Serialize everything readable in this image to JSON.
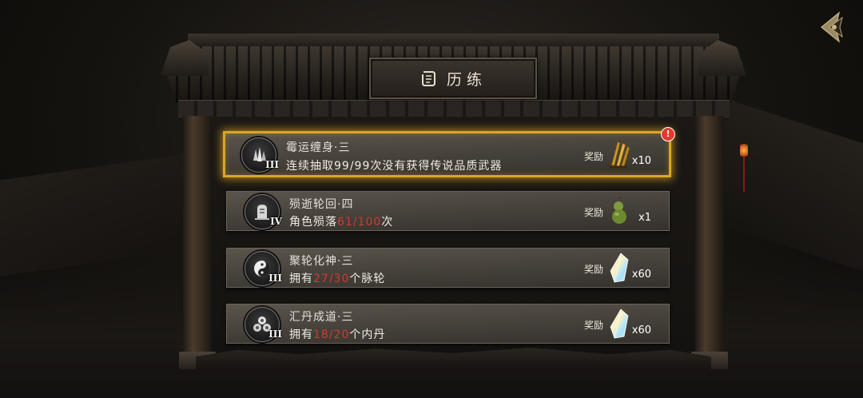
{
  "header": {
    "title": "历练"
  },
  "quests": [
    {
      "title": "霉运缠身·三",
      "rank": "III",
      "desc_before": "连续抽取99/99次没有获得传说品质武器",
      "progress": "",
      "desc_after": "",
      "reward_label": "奖励",
      "reward_count": "x10",
      "reward_icon": "golden-feather-icon",
      "badge_icon": "crystal-icon",
      "alert": "!"
    },
    {
      "title": "殒逝轮回·四",
      "rank": "IV",
      "desc_before": "角色殒落",
      "progress": "61/100",
      "desc_after": "次",
      "reward_label": "奖励",
      "reward_count": "x1",
      "reward_icon": "green-gourd-icon",
      "badge_icon": "tombstone-icon"
    },
    {
      "title": "聚轮化神·三",
      "rank": "III",
      "desc_before": "拥有",
      "progress": "27/30",
      "desc_after": "个脉轮",
      "reward_label": "奖励",
      "reward_count": "x60",
      "reward_icon": "iridescent-crystal-icon",
      "badge_icon": "yin-yang-icon"
    },
    {
      "title": "汇丹成道·三",
      "rank": "III",
      "desc_before": "拥有",
      "progress": "18/20",
      "desc_after": "个内丹",
      "reward_label": "奖励",
      "reward_count": "x60",
      "reward_icon": "iridescent-crystal-icon",
      "badge_icon": "triple-orb-icon"
    }
  ],
  "colors": {
    "highlight": "#d03a30",
    "active_border": "#d9a728"
  }
}
